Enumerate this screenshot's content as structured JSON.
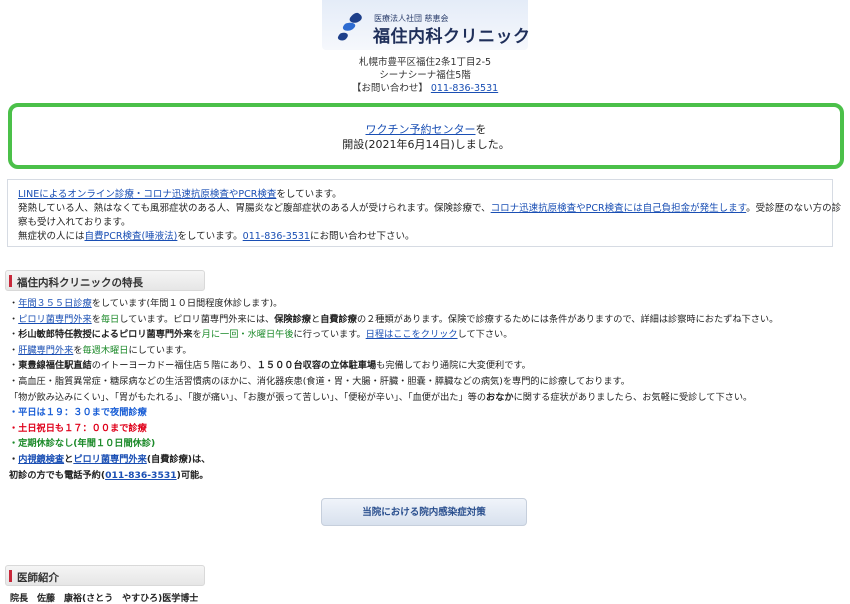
{
  "header": {
    "org": "医療法人社団 慈恵会",
    "clinic_name": "福住内科クリニック"
  },
  "address": {
    "line1": "札幌市豊平区福住2条1丁目2-5",
    "line2": "シーナシーナ福住5階",
    "contact_label": "【お問い合わせ】",
    "phone": "011-836-3531"
  },
  "notice": {
    "link": "ワクチン予約センター",
    "after_link": "を",
    "line2": "開設(2021年6月14日)しました。"
  },
  "info": {
    "l1_link": "LINEによるオンライン診療・コロナ迅速抗原検査やPCR検査",
    "l1_rest": "をしています。",
    "l2_pre": "発熱している人、熱はなくても風邪症状のある人、胃腸炎など腹部症状のある人が受けられます。保険診療で、",
    "l2_link": "コロナ迅速抗原検査やPCR検査には自己負担金が発生します",
    "l2_post": "。受診歴のない方の診",
    "l3": "察も受け入れております。",
    "l4_pre": "無症状の人には",
    "l4_link1": "自費PCR検査(唾液法)",
    "l4_mid": "をしています。",
    "l4_link2": "011-836-3531",
    "l4_post": "にお問い合わせ下さい。"
  },
  "features": {
    "title": "福住内科クリニックの特長",
    "f1_pre": "・",
    "f1_link": "年間３５５日診療",
    "f1_post": "をしています(年間１０日間程度休診します)。",
    "f2_link": "ピロリ菌専門外来",
    "f2_mid1": "を",
    "f2_mid1b": "毎日",
    "f2_mid2": "しています。ピロリ菌専門外来には、",
    "f2_b1": "保険診療",
    "f2_mid3": "と",
    "f2_b2": "自費診療",
    "f2_post": "の２種類があります。保険で診療するためには条件がありますので、詳細は診察時におたずね下さい。",
    "f3_b": "杉山敏郎特任教授によるピロリ菌専門外来",
    "f3_mid": "を",
    "f3_green": "月に一回・水曜日午後",
    "f3_mid2": "に行っています。",
    "f3_link": "日程はここをクリック",
    "f3_post": "して下さい。",
    "f4_link": "肝臓専門外来",
    "f4_mid": "を",
    "f4_green": "毎週木曜日",
    "f4_post": "にしています。",
    "f5_b1": "東豊線福住駅直結",
    "f5_mid": "のイトーヨーカドー福住店５階にあり、",
    "f5_b2": "１５００台収容の立体駐車場",
    "f5_post": "も完備しており通院に大変便利です。",
    "f6": "・高血圧・脂質異常症・糖尿病などの生活習慣病のほかに、消化器疾患(食道・胃・大腸・肝臓・胆嚢・膵臓などの病気)を専門的に診療しております。",
    "f7_pre": "「物が飲み込みにくい」、「胃がもたれる」、「腹が痛い」、「お腹が張って苦しい」、「便秘が辛い」、「血便が出た」等の",
    "f7_b": "おなか",
    "f7_post": "に関する症状がありましたら、お気軽に受診して下さい。",
    "f8": "・平日は１９：３０まで夜間診療",
    "f9": "・土日祝日も１７：００まで診療",
    "f10": "・定期休診なし(年間１０日間休診)",
    "f11_link1": "内視鏡検査",
    "f11_mid": "と",
    "f11_link2": "ピロリ菌専門外来",
    "f11_post": "(自費診療)は、",
    "f12_pre": "初診の方でも電話予約(",
    "f12_link": "011-836-3531",
    "f12_post": ")可能。"
  },
  "covid_button": "当院における院内感染症対策",
  "doctors": {
    "title": "医師紹介",
    "line": "院長　佐藤　康裕(さとう　やすひろ)医学博士"
  }
}
